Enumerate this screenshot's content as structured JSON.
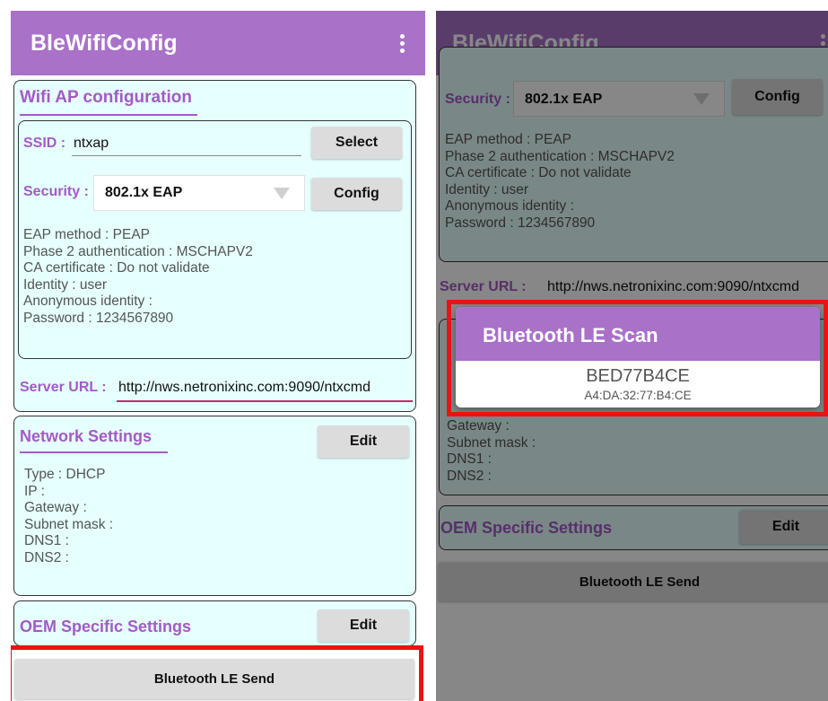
{
  "app_title": "BleWifiConfig",
  "wifi": {
    "section_title": "Wifi AP configuration",
    "ssid_label": "SSID :",
    "ssid_value": "ntxap",
    "select_button": "Select",
    "security_label": "Security :",
    "security_value": "802.1x EAP",
    "config_button": "Config",
    "eap_info": "EAP method : PEAP\nPhase 2 authentication : MSCHAPV2\nCA certificate : Do not validate\nIdentity : user\nAnonymous identity :\nPassword : 1234567890"
  },
  "server": {
    "label": "Server URL :",
    "value": "http://nws.netronixinc.com:9090/ntxcmd"
  },
  "network": {
    "section_title": "Network Settings",
    "edit_button": "Edit",
    "info": "Type : DHCP\nIP :\nGateway :\nSubnet mask :\nDNS1 :\nDNS2 :",
    "info_partial": "Gateway :\nSubnet mask :\nDNS1 :\nDNS2 :"
  },
  "oem": {
    "section_title": "OEM Specific Settings",
    "edit_button": "Edit"
  },
  "send_button": "Bluetooth LE Send",
  "scan_dialog": {
    "title": "Bluetooth LE Scan",
    "devices": [
      {
        "name": "BED77B4CE",
        "address": "A4:DA:32:77:B4:CE"
      }
    ]
  },
  "colors": {
    "app_bar": "#a971c8",
    "accent": "#a35bc4",
    "panel_bg": "#e6ffff",
    "highlight_red": "#ee1111"
  }
}
